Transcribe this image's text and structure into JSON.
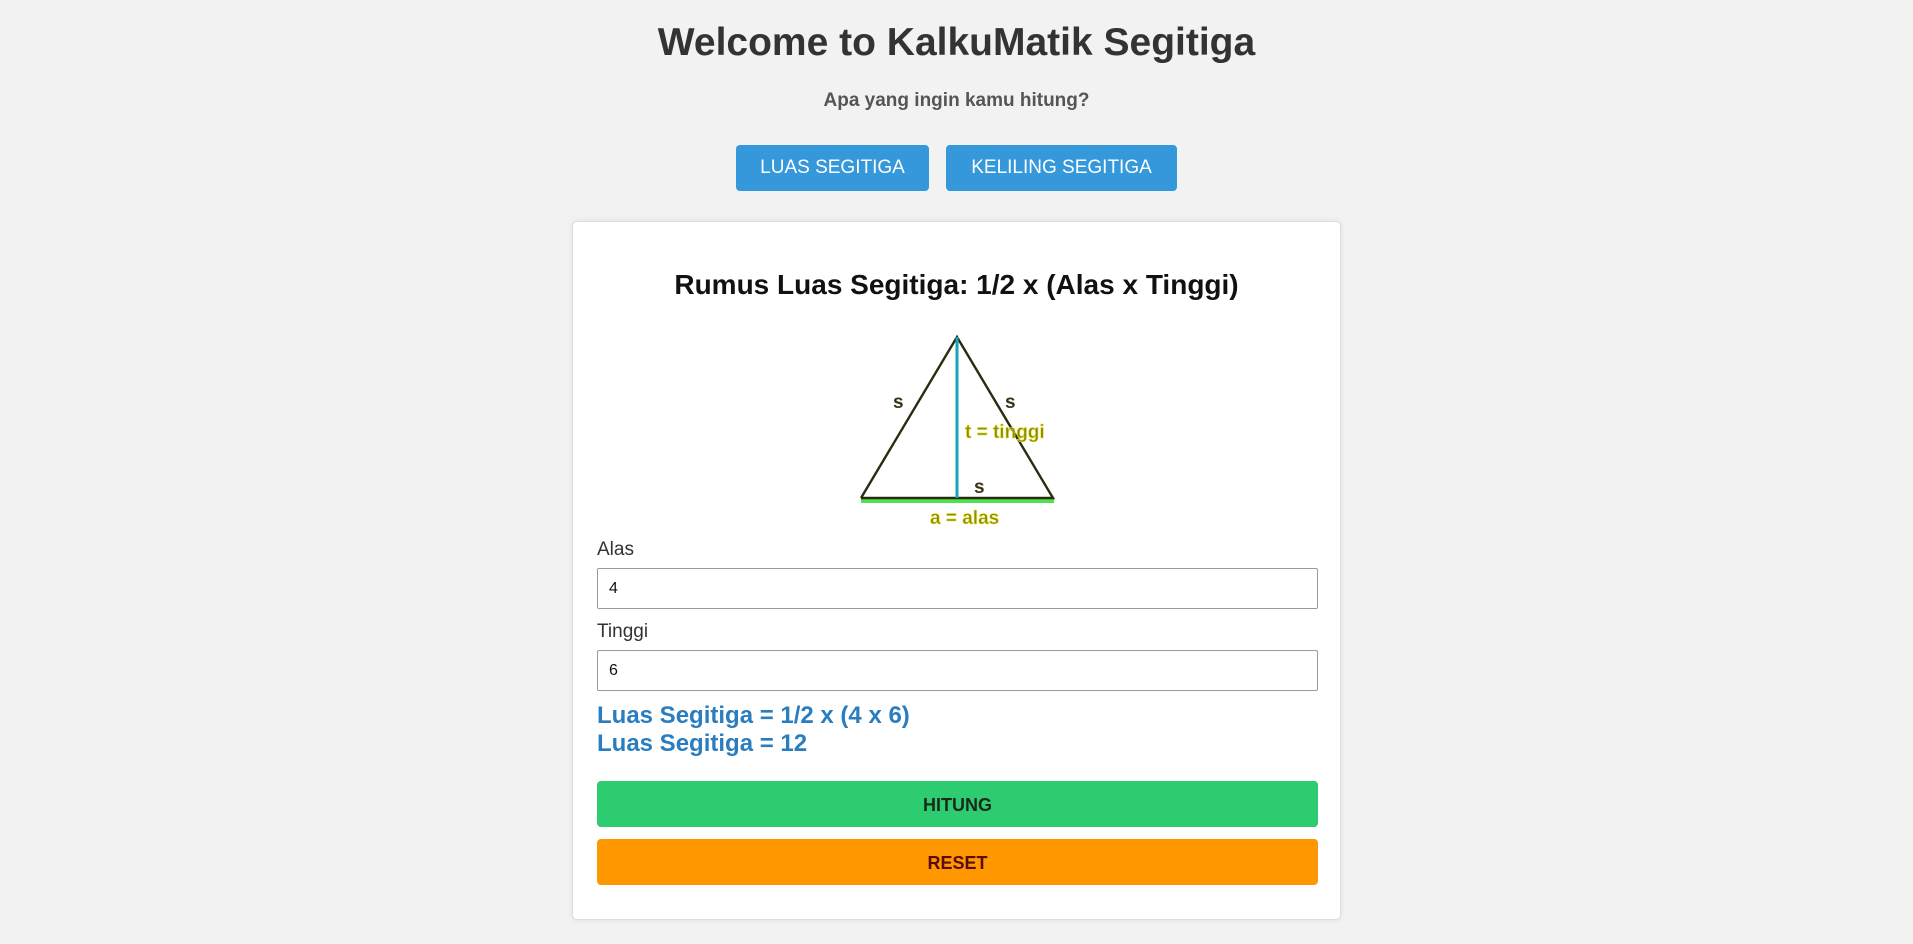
{
  "header": {
    "title": "Welcome to KalkuMatik Segitiga",
    "subtitle": "Apa yang ingin kamu hitung?"
  },
  "mode_buttons": {
    "luas_label": "LUAS SEGITIGA",
    "keliling_label": "KELILING SEGITIGA"
  },
  "calculator": {
    "formula_title": "Rumus Luas Segitiga: 1/2 x (Alas x Tinggi)",
    "figure": {
      "side_label_left": "s",
      "side_label_right": "s",
      "side_label_bottom": "s",
      "height_label": "t = tinggi",
      "base_label": "a = alas"
    },
    "alas": {
      "label": "Alas",
      "value": "4"
    },
    "tinggi": {
      "label": "Tinggi",
      "value": "6"
    },
    "result_line1": "Luas Segitiga = 1/2 x (4 x 6)",
    "result_line2": "Luas Segitiga = 12",
    "hitung_label": "HITUNG",
    "reset_label": "RESET"
  },
  "colors": {
    "primary": "#3498db",
    "success": "#2ecc71",
    "warning": "#ff9800",
    "result_text": "#2a7dbf"
  }
}
